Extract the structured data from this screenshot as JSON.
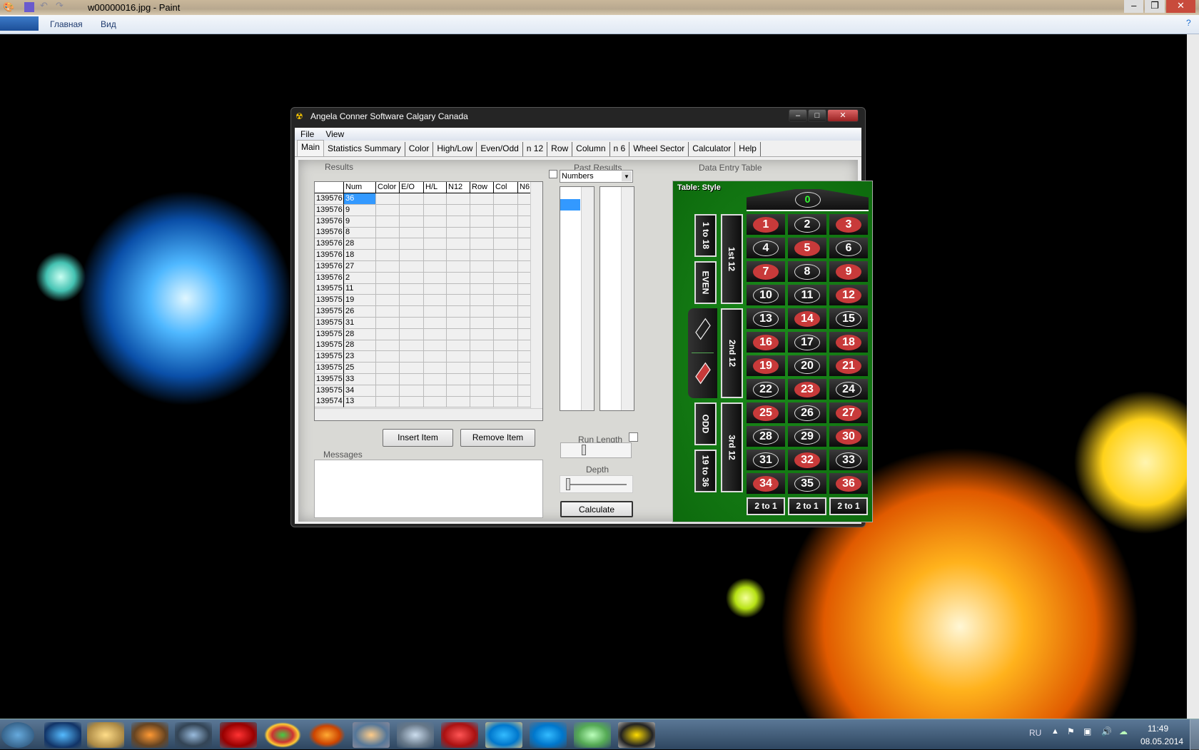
{
  "paint": {
    "title": "w00000016.jpg - Paint",
    "tabs": [
      "Главная",
      "Вид"
    ]
  },
  "app": {
    "title": "Angela Conner Software  Calgary Canada",
    "menu": [
      "File",
      "View"
    ],
    "tabs": [
      "Main",
      "Statistics Summary",
      "Color",
      "High/Low",
      "Even/Odd",
      "n 12",
      "Row",
      "Column",
      "n 6",
      "Wheel Sector",
      "Calculator",
      "Help"
    ],
    "results": {
      "label": "Results",
      "columns": [
        "",
        "Num",
        "Color",
        "E/O",
        "H/L",
        "N12",
        "Row",
        "Col",
        "N6"
      ],
      "rows": [
        [
          "139576",
          "36"
        ],
        [
          "139576",
          "9"
        ],
        [
          "139576",
          "9"
        ],
        [
          "139576",
          "8"
        ],
        [
          "139576",
          "28"
        ],
        [
          "139576",
          "18"
        ],
        [
          "139576",
          "27"
        ],
        [
          "139576",
          "2"
        ],
        [
          "139575",
          "11"
        ],
        [
          "139575",
          "19"
        ],
        [
          "139575",
          "26"
        ],
        [
          "139575",
          "31"
        ],
        [
          "139575",
          "28"
        ],
        [
          "139575",
          "28"
        ],
        [
          "139575",
          "23"
        ],
        [
          "139575",
          "25"
        ],
        [
          "139575",
          "33"
        ],
        [
          "139575",
          "34"
        ],
        [
          "139574",
          "13"
        ]
      ]
    },
    "insert_label": "Insert Item",
    "remove_label": "Remove Item",
    "messages_label": "Messages",
    "past_results_label": "Past Results",
    "combo_value": "Numbers",
    "run_length_label": "Run Length",
    "depth_label": "Depth",
    "calculate_label": "Calculate",
    "run_length_value": 0.3,
    "depth_value": 0,
    "data_entry_label": "Data Entry Table",
    "table": {
      "style_label": "Table: Style",
      "zero": "0",
      "red": [
        1,
        3,
        5,
        7,
        9,
        12,
        14,
        16,
        18,
        19,
        21,
        23,
        25,
        27,
        30,
        32,
        34,
        36
      ],
      "numbers": [
        "1",
        "2",
        "3",
        "4",
        "5",
        "6",
        "7",
        "8",
        "9",
        "10",
        "11",
        "12",
        "13",
        "14",
        "15",
        "16",
        "17",
        "18",
        "19",
        "20",
        "21",
        "22",
        "23",
        "24",
        "25",
        "26",
        "27",
        "28",
        "29",
        "30",
        "31",
        "32",
        "33",
        "34",
        "35",
        "36"
      ],
      "dozens": [
        "1st 12",
        "2nd 12",
        "3rd 12"
      ],
      "outside": [
        "1 to 18",
        "EVEN",
        "ODD",
        "19 to 36"
      ],
      "columns": [
        "2 to 1",
        "2 to 1",
        "2 to 1"
      ]
    }
  },
  "tray": {
    "lang": "RU",
    "time": "11:49",
    "date": "08.05.2014"
  }
}
